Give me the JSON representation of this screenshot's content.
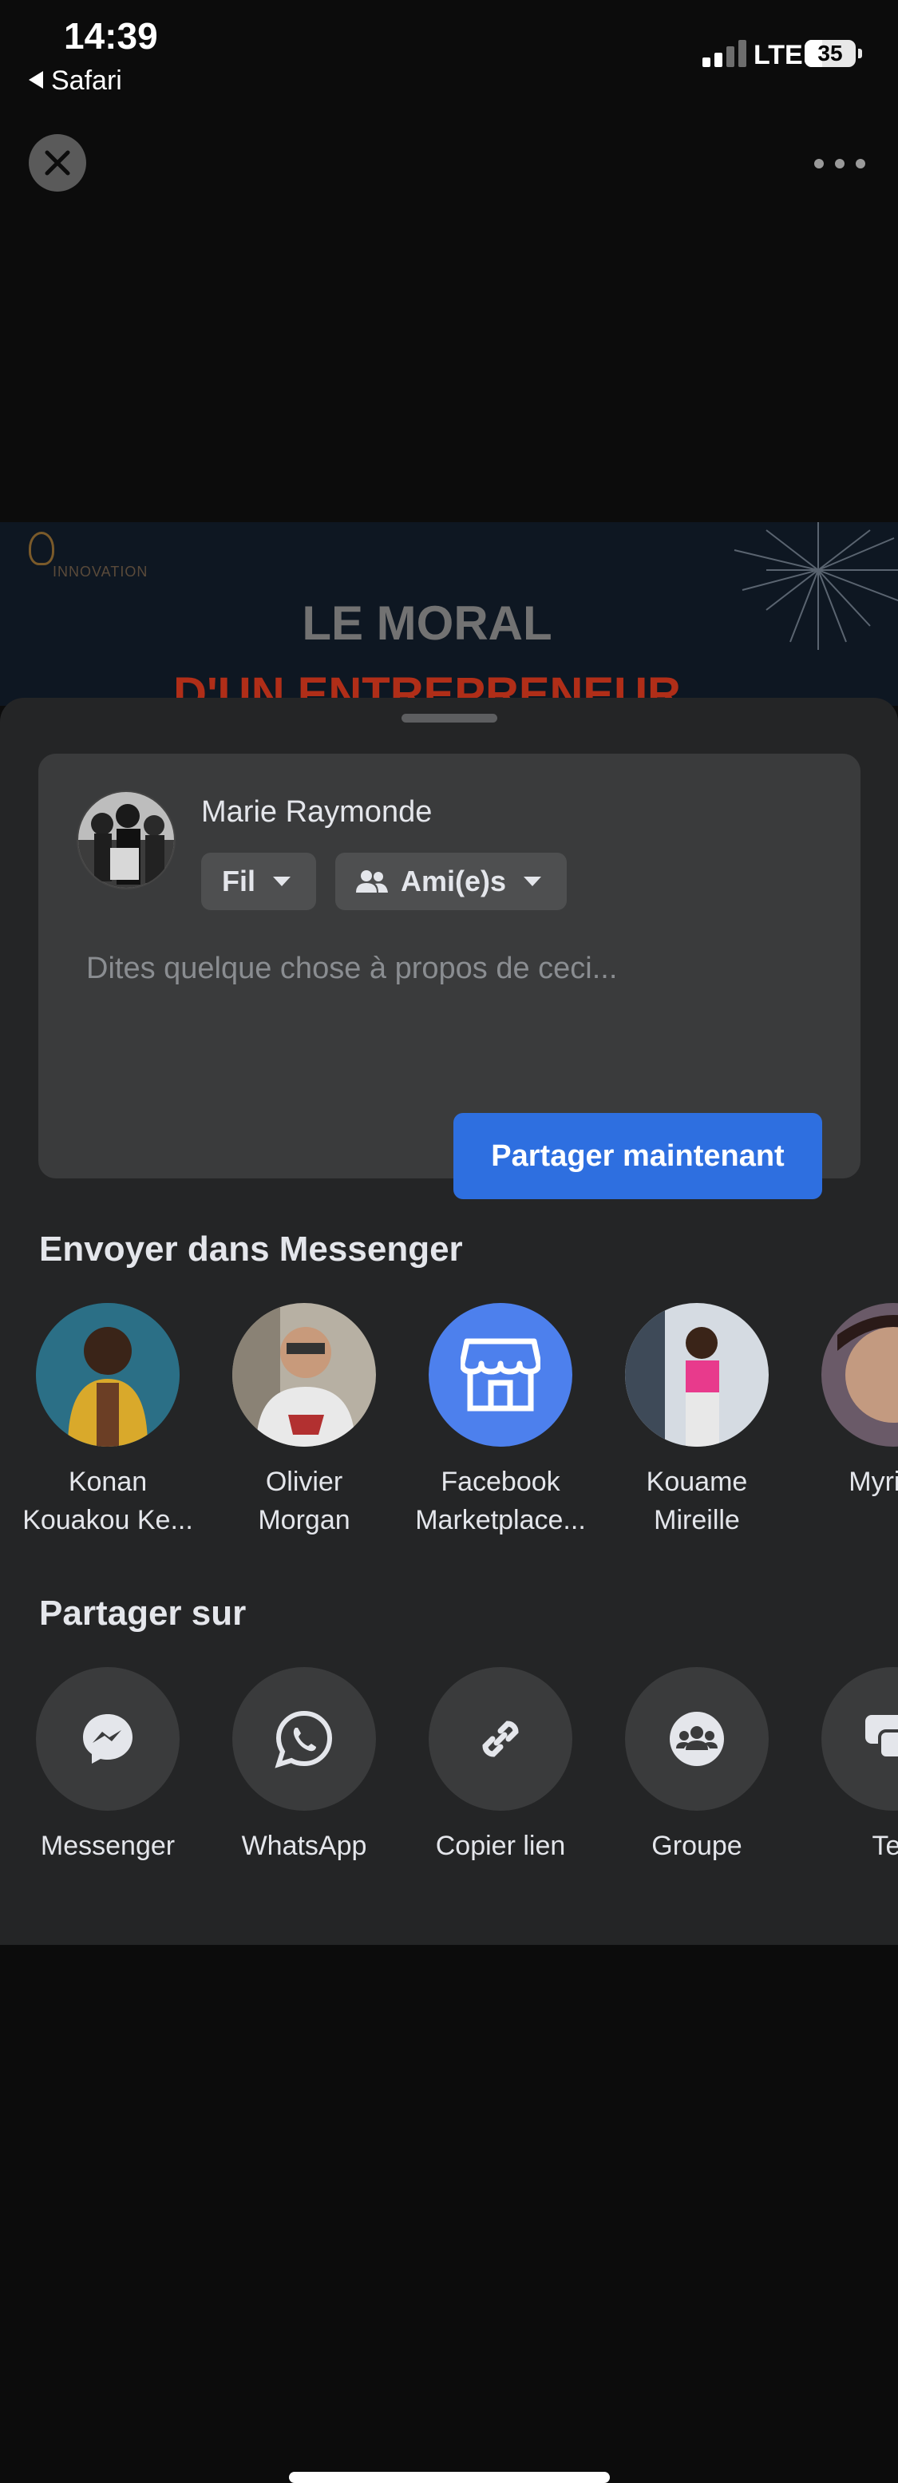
{
  "status_bar": {
    "time": "14:39",
    "back_app": "Safari",
    "network": "LTE",
    "battery": "35",
    "battery_level": 0.35
  },
  "top_bar": {
    "close_icon": "close-icon",
    "more_icon": "more-horizontal-icon"
  },
  "preview": {
    "brand": "INNOVATION",
    "title_line1": "LE MORAL",
    "title_line2": "D'UN ENTREPRENEUR"
  },
  "composer": {
    "user_name": "Marie Raymonde",
    "destination": "Fil",
    "audience": "Ami(e)s",
    "placeholder": "Dites quelque chose à propos de ceci...",
    "share_button": "Partager maintenant"
  },
  "messenger": {
    "title": "Envoyer dans Messenger",
    "contacts": [
      {
        "line1": "Konan",
        "line2": "Kouakou Ke..."
      },
      {
        "line1": "Olivier",
        "line2": "Morgan"
      },
      {
        "line1": "Facebook",
        "line2": "Marketplace..."
      },
      {
        "line1": "Kouame",
        "line2": "Mireille"
      },
      {
        "line1": "Myriam",
        "line2": ""
      }
    ]
  },
  "share_on": {
    "title": "Partager sur",
    "targets": [
      {
        "label": "Messenger",
        "icon": "messenger-icon"
      },
      {
        "label": "WhatsApp",
        "icon": "whatsapp-icon"
      },
      {
        "label": "Copier lien",
        "icon": "link-icon"
      },
      {
        "label": "Groupe",
        "icon": "group-icon"
      },
      {
        "label": "Tex",
        "icon": "text-message-icon"
      }
    ]
  },
  "colors": {
    "sheet_bg": "#242526",
    "card_bg": "#3a3b3c",
    "accent": "#2e6fe0",
    "marketplace": "#4d80ed"
  }
}
